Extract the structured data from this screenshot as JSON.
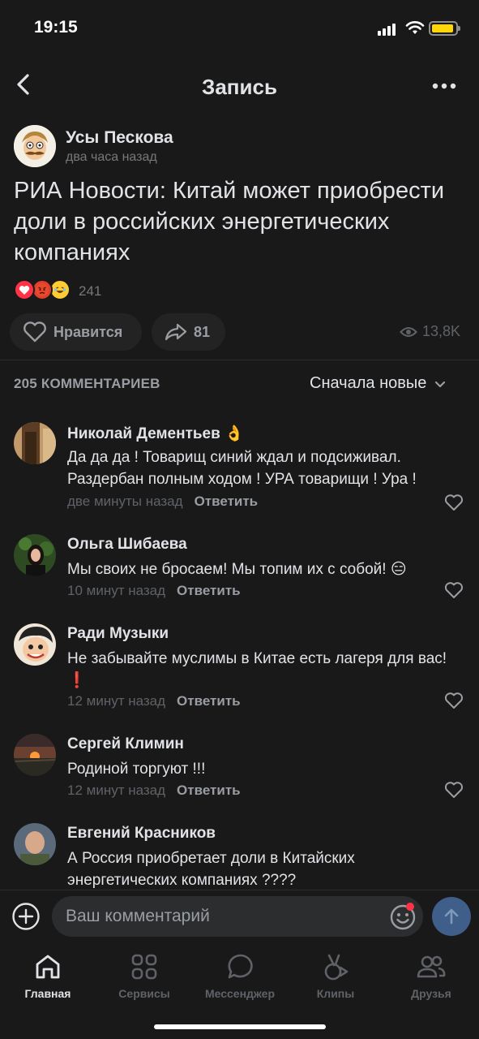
{
  "status_bar": {
    "time": "19:15"
  },
  "header": {
    "title": "Запись",
    "back_icon": "chevron-left-icon",
    "more_icon": "more-horizontal-icon"
  },
  "post": {
    "author": "Усы Пескова",
    "time": "два часа назад",
    "text": "РИА Новости: Китай может приобрести доли в российских энергетических компаниях",
    "reactions": {
      "icons": [
        "heart-icon",
        "angry-face-icon",
        "laughing-face-icon"
      ],
      "count": "241"
    },
    "actions": {
      "like_label": "Нравится",
      "share_count": "81",
      "views": "13,8K"
    }
  },
  "comments_section": {
    "header": "205 КОММЕНТАРИЕВ",
    "sort_label": "Сначала новые",
    "reply_label": "Ответить",
    "items": [
      {
        "name": "Николай Дементьев",
        "badge": "👌",
        "text": "Да да да ! Товарищ синий ждал и подсиживал. Раздербан полным ходом ! УРА товарищи ! Ура !",
        "time": "две минуты назад"
      },
      {
        "name": "Ольга Шибаева",
        "text": "Мы своих не бросаем! Мы топим их с собой! 😑",
        "time": "10 минут назад"
      },
      {
        "name": "Ради Музыки",
        "text": "Не забывайте муслимы в Китае есть лагеря для вас! ❗",
        "time": "12 минут назад"
      },
      {
        "name": "Сергей Климин",
        "text": "Родиной торгуют !!!",
        "time": "12 минут назад"
      },
      {
        "name": "Евгений Красников",
        "text": "А Россия приобретает доли в Китайских энергетических компаниях ????"
      }
    ]
  },
  "comment_input": {
    "placeholder": "Ваш комментарий"
  },
  "tab_bar": {
    "items": [
      {
        "label": "Главная",
        "icon": "home-icon",
        "active": true
      },
      {
        "label": "Сервисы",
        "icon": "services-icon"
      },
      {
        "label": "Мессенджер",
        "icon": "messenger-icon"
      },
      {
        "label": "Клипы",
        "icon": "clips-icon"
      },
      {
        "label": "Друзья",
        "icon": "friends-icon"
      }
    ]
  },
  "colors": {
    "background": "#19191a",
    "accent": "#3f5e8a",
    "like_red": "#ff3347"
  }
}
